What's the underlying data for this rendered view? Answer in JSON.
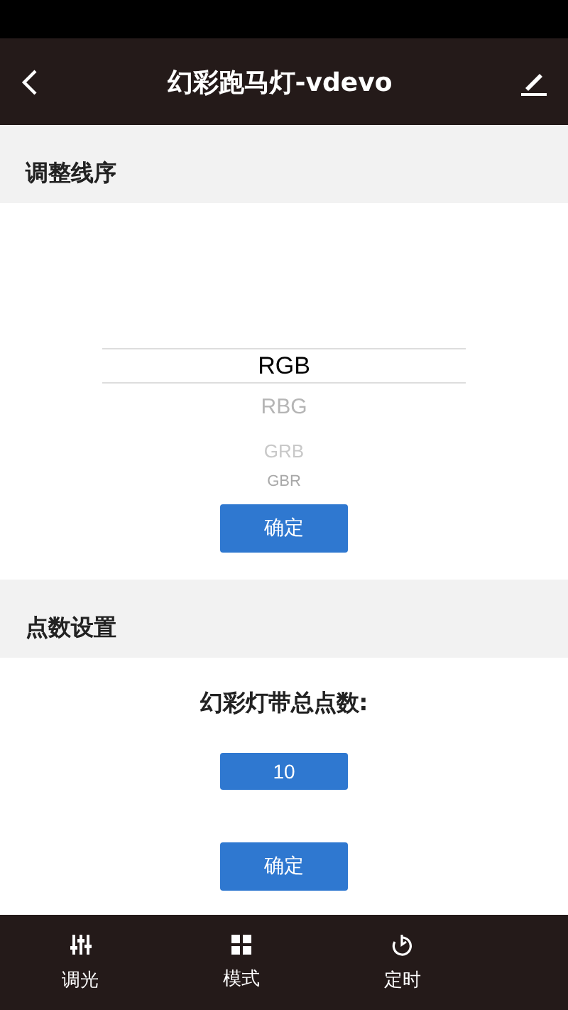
{
  "header": {
    "title": "幻彩跑马灯-vdevo"
  },
  "wiring": {
    "title": "调整线序",
    "options": [
      {
        "label": "RGB",
        "selected": true
      },
      {
        "label": "RBG",
        "selected": false
      },
      {
        "label": "GRB",
        "selected": false
      },
      {
        "label": "GBR",
        "selected": false
      }
    ],
    "button": "确定"
  },
  "points": {
    "title": "点数设置",
    "label": "幻彩灯带总点数:",
    "value": "10",
    "button": "确定"
  },
  "nav": [
    {
      "kind": "sliders",
      "label": "调光"
    },
    {
      "kind": "grid",
      "label": "模式"
    },
    {
      "kind": "timer",
      "label": "定时"
    }
  ]
}
